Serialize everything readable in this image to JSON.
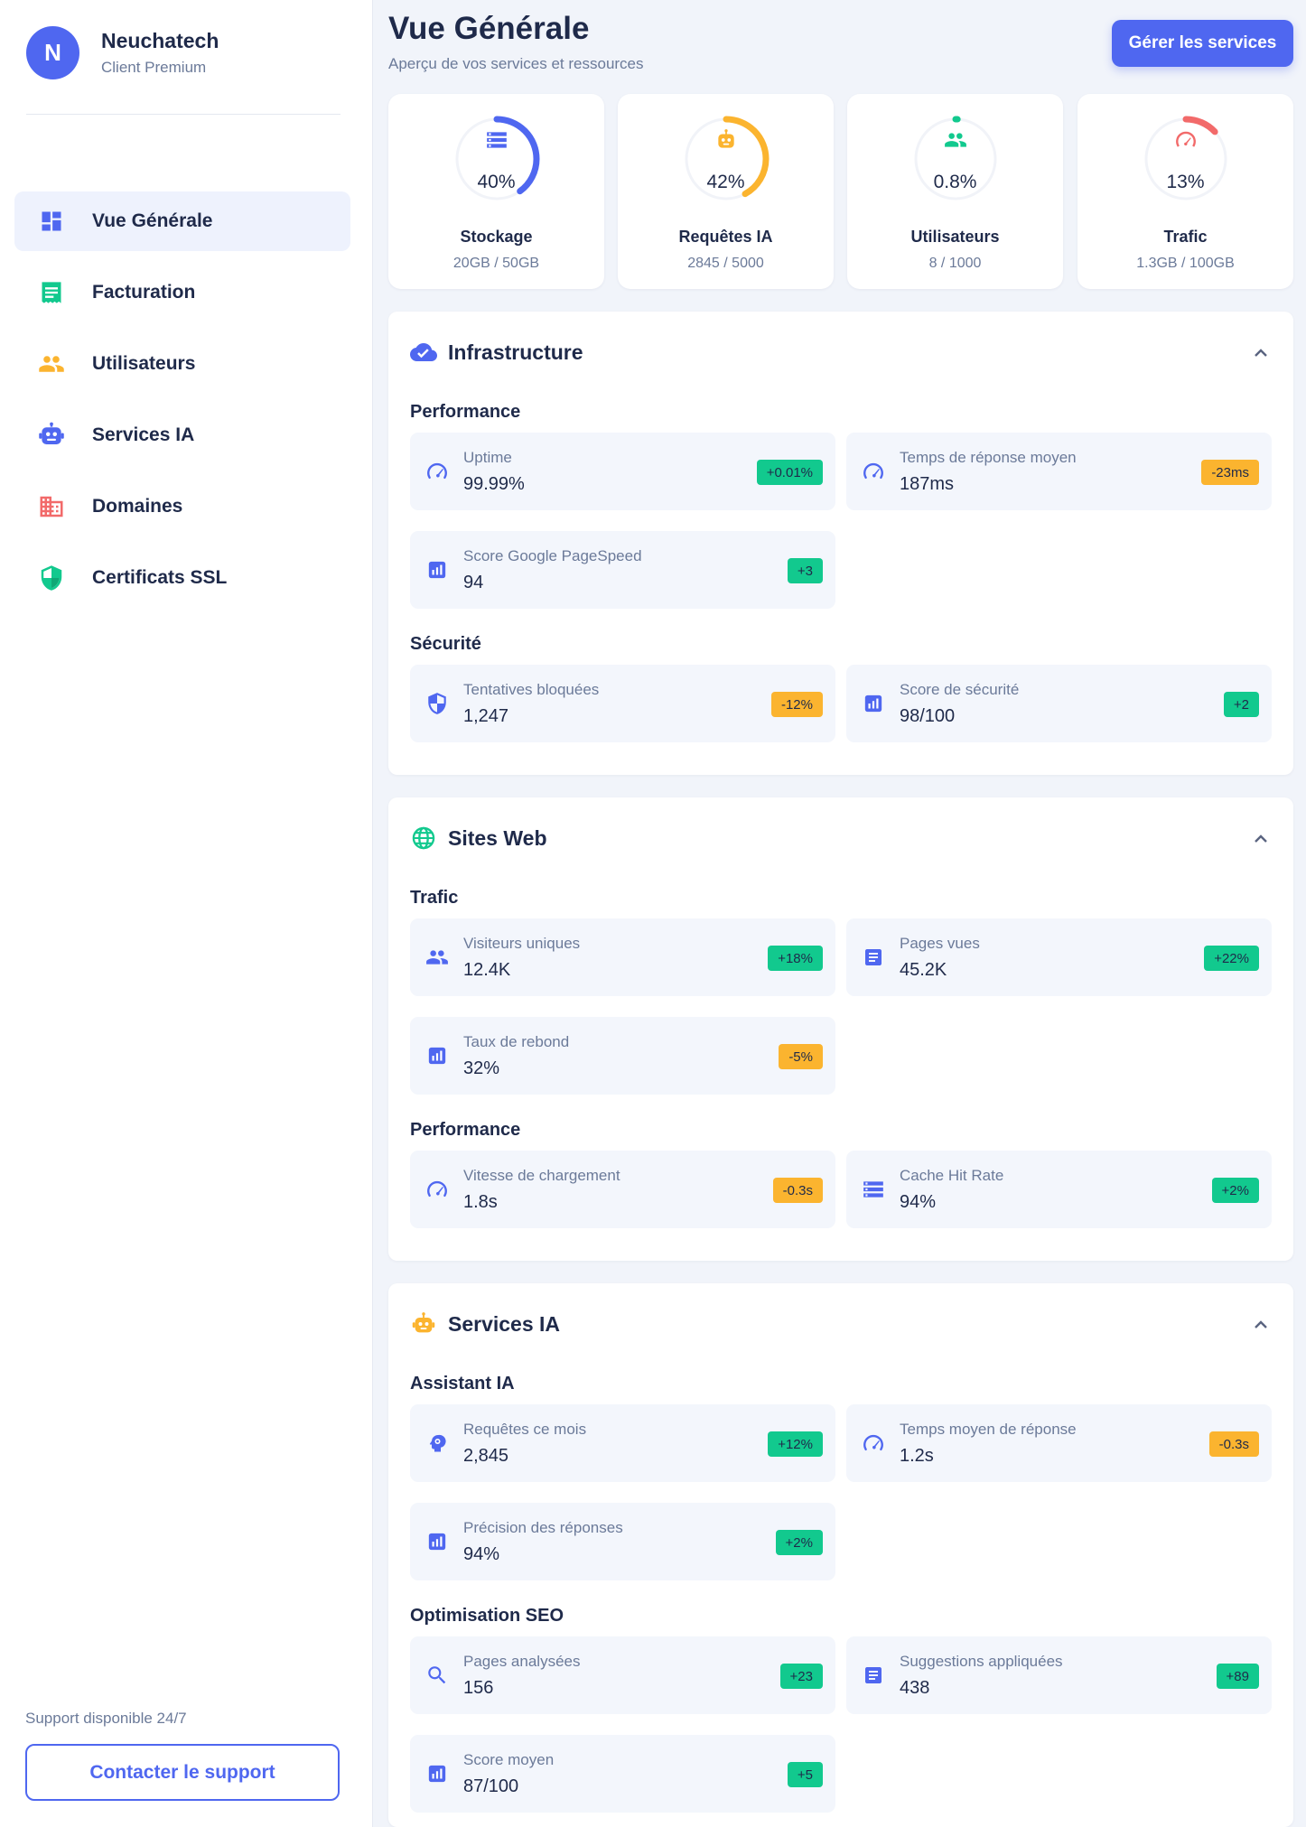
{
  "sidebar": {
    "brand": {
      "initial": "N",
      "name": "Neuchatech",
      "plan": "Client Premium"
    },
    "items": [
      {
        "label": "Vue Générale",
        "icon": "dashboard-icon",
        "active": true
      },
      {
        "label": "Facturation",
        "icon": "receipt-icon"
      },
      {
        "label": "Utilisateurs",
        "icon": "users-icon"
      },
      {
        "label": "Services IA",
        "icon": "robot-icon"
      },
      {
        "label": "Domaines",
        "icon": "building-icon"
      },
      {
        "label": "Certificats SSL",
        "icon": "shield-icon"
      }
    ],
    "support_text": "Support disponible 24/7",
    "support_button": "Contacter le support"
  },
  "header": {
    "title": "Vue Générale",
    "subtitle": "Aperçu de vos services et ressources",
    "manage_button": "Gérer les services"
  },
  "stats": [
    {
      "pct": "40%",
      "fraction": 0.4,
      "label": "Stockage",
      "detail": "20GB / 50GB",
      "color": "#4f67f0",
      "icon": "storage-icon"
    },
    {
      "pct": "42%",
      "fraction": 0.42,
      "label": "Requêtes IA",
      "detail": "2845 / 5000",
      "color": "#fbb42f",
      "icon": "robot-icon"
    },
    {
      "pct": "0.8%",
      "fraction": 0.008,
      "label": "Utilisateurs",
      "detail": "8 / 1000",
      "color": "#12c98e",
      "icon": "users-icon"
    },
    {
      "pct": "13%",
      "fraction": 0.13,
      "label": "Trafic",
      "detail": "1.3GB / 100GB",
      "color": "#f26a6a",
      "icon": "speedometer-icon"
    }
  ],
  "sections": [
    {
      "title": "Infrastructure",
      "icon": "cloud-check-icon",
      "groups": [
        {
          "title": "Performance",
          "metrics": [
            {
              "label": "Uptime",
              "value": "99.99%",
              "badge": "+0.01%",
              "trend": "pos",
              "icon": "speedometer-icon"
            },
            {
              "label": "Temps de réponse moyen",
              "value": "187ms",
              "badge": "-23ms",
              "trend": "neg",
              "icon": "speedometer-icon"
            },
            {
              "label": "Score Google PageSpeed",
              "value": "94",
              "badge": "+3",
              "trend": "pos",
              "icon": "chart-icon"
            }
          ]
        },
        {
          "title": "Sécurité",
          "metrics": [
            {
              "label": "Tentatives bloquées",
              "value": "1,247",
              "badge": "-12%",
              "trend": "neg",
              "icon": "shield-icon"
            },
            {
              "label": "Score de sécurité",
              "value": "98/100",
              "badge": "+2",
              "trend": "pos",
              "icon": "chart-icon"
            }
          ]
        }
      ]
    },
    {
      "title": "Sites Web",
      "icon": "globe-icon",
      "groups": [
        {
          "title": "Trafic",
          "metrics": [
            {
              "label": "Visiteurs uniques",
              "value": "12.4K",
              "badge": "+18%",
              "trend": "pos",
              "icon": "users-icon"
            },
            {
              "label": "Pages vues",
              "value": "45.2K",
              "badge": "+22%",
              "trend": "pos",
              "icon": "document-icon"
            },
            {
              "label": "Taux de rebond",
              "value": "32%",
              "badge": "-5%",
              "trend": "neg",
              "icon": "chart-icon"
            }
          ]
        },
        {
          "title": "Performance",
          "metrics": [
            {
              "label": "Vitesse de chargement",
              "value": "1.8s",
              "badge": "-0.3s",
              "trend": "neg",
              "icon": "speedometer-icon"
            },
            {
              "label": "Cache Hit Rate",
              "value": "94%",
              "badge": "+2%",
              "trend": "pos",
              "icon": "storage-icon"
            }
          ]
        }
      ]
    },
    {
      "title": "Services IA",
      "icon": "robot-icon",
      "groups": [
        {
          "title": "Assistant IA",
          "metrics": [
            {
              "label": "Requêtes ce mois",
              "value": "2,845",
              "badge": "+12%",
              "trend": "pos",
              "icon": "brain-icon"
            },
            {
              "label": "Temps moyen de réponse",
              "value": "1.2s",
              "badge": "-0.3s",
              "trend": "neg",
              "icon": "speedometer-icon"
            },
            {
              "label": "Précision des réponses",
              "value": "94%",
              "badge": "+2%",
              "trend": "pos",
              "icon": "chart-icon"
            }
          ]
        },
        {
          "title": "Optimisation SEO",
          "metrics": [
            {
              "label": "Pages analysées",
              "value": "156",
              "badge": "+23",
              "trend": "pos",
              "icon": "search-icon"
            },
            {
              "label": "Suggestions appliquées",
              "value": "438",
              "badge": "+89",
              "trend": "pos",
              "icon": "document-icon"
            },
            {
              "label": "Score moyen",
              "value": "87/100",
              "badge": "+5",
              "trend": "pos",
              "icon": "chart-icon"
            }
          ]
        }
      ]
    }
  ],
  "colors": {
    "accent": "#4f67f0",
    "positive": "#12c98e",
    "warning": "#fbb42f",
    "danger": "#f26a6a",
    "text": "#1f2a4a",
    "muted": "#6b7a99"
  }
}
